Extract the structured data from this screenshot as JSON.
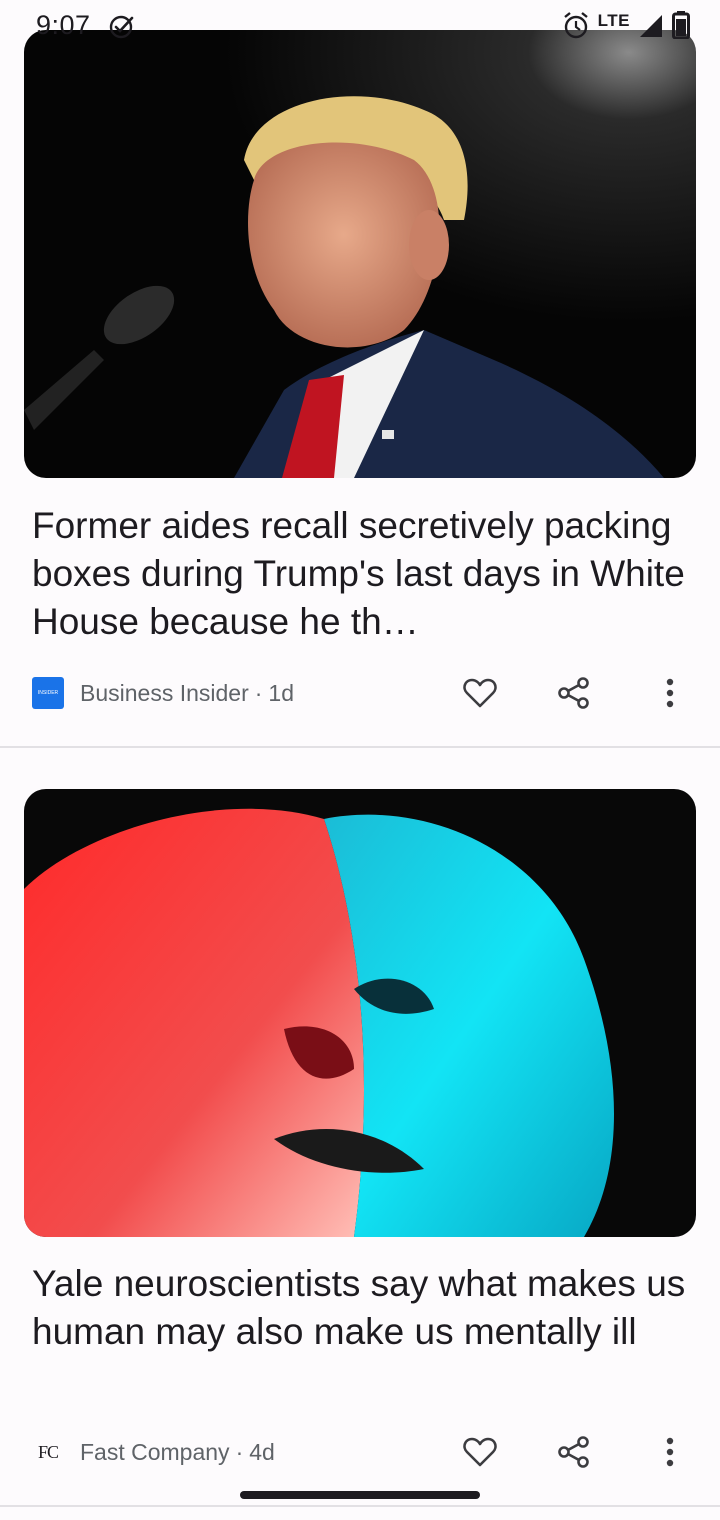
{
  "status_bar": {
    "time": "9:07",
    "network": "LTE"
  },
  "articles": [
    {
      "headline": "Former aides recall secretively packing boxes during Trump's last days in White House because he th…",
      "source": "Business Insider",
      "source_logo_text": "INSIDER",
      "age": "1d",
      "image_desc_icon": "photo-icon"
    },
    {
      "headline": "Yale neuroscientists say what makes us human may also make us mentally ill",
      "source": "Fast Company",
      "source_logo_text": "FC",
      "age": "4d",
      "image_desc_icon": "photo-icon"
    }
  ],
  "separator": "·",
  "colors": {
    "accent_blue": "#1a73e8",
    "text_primary": "#1d1b20",
    "text_secondary": "#5f6368",
    "background": "#fdfbfd"
  }
}
